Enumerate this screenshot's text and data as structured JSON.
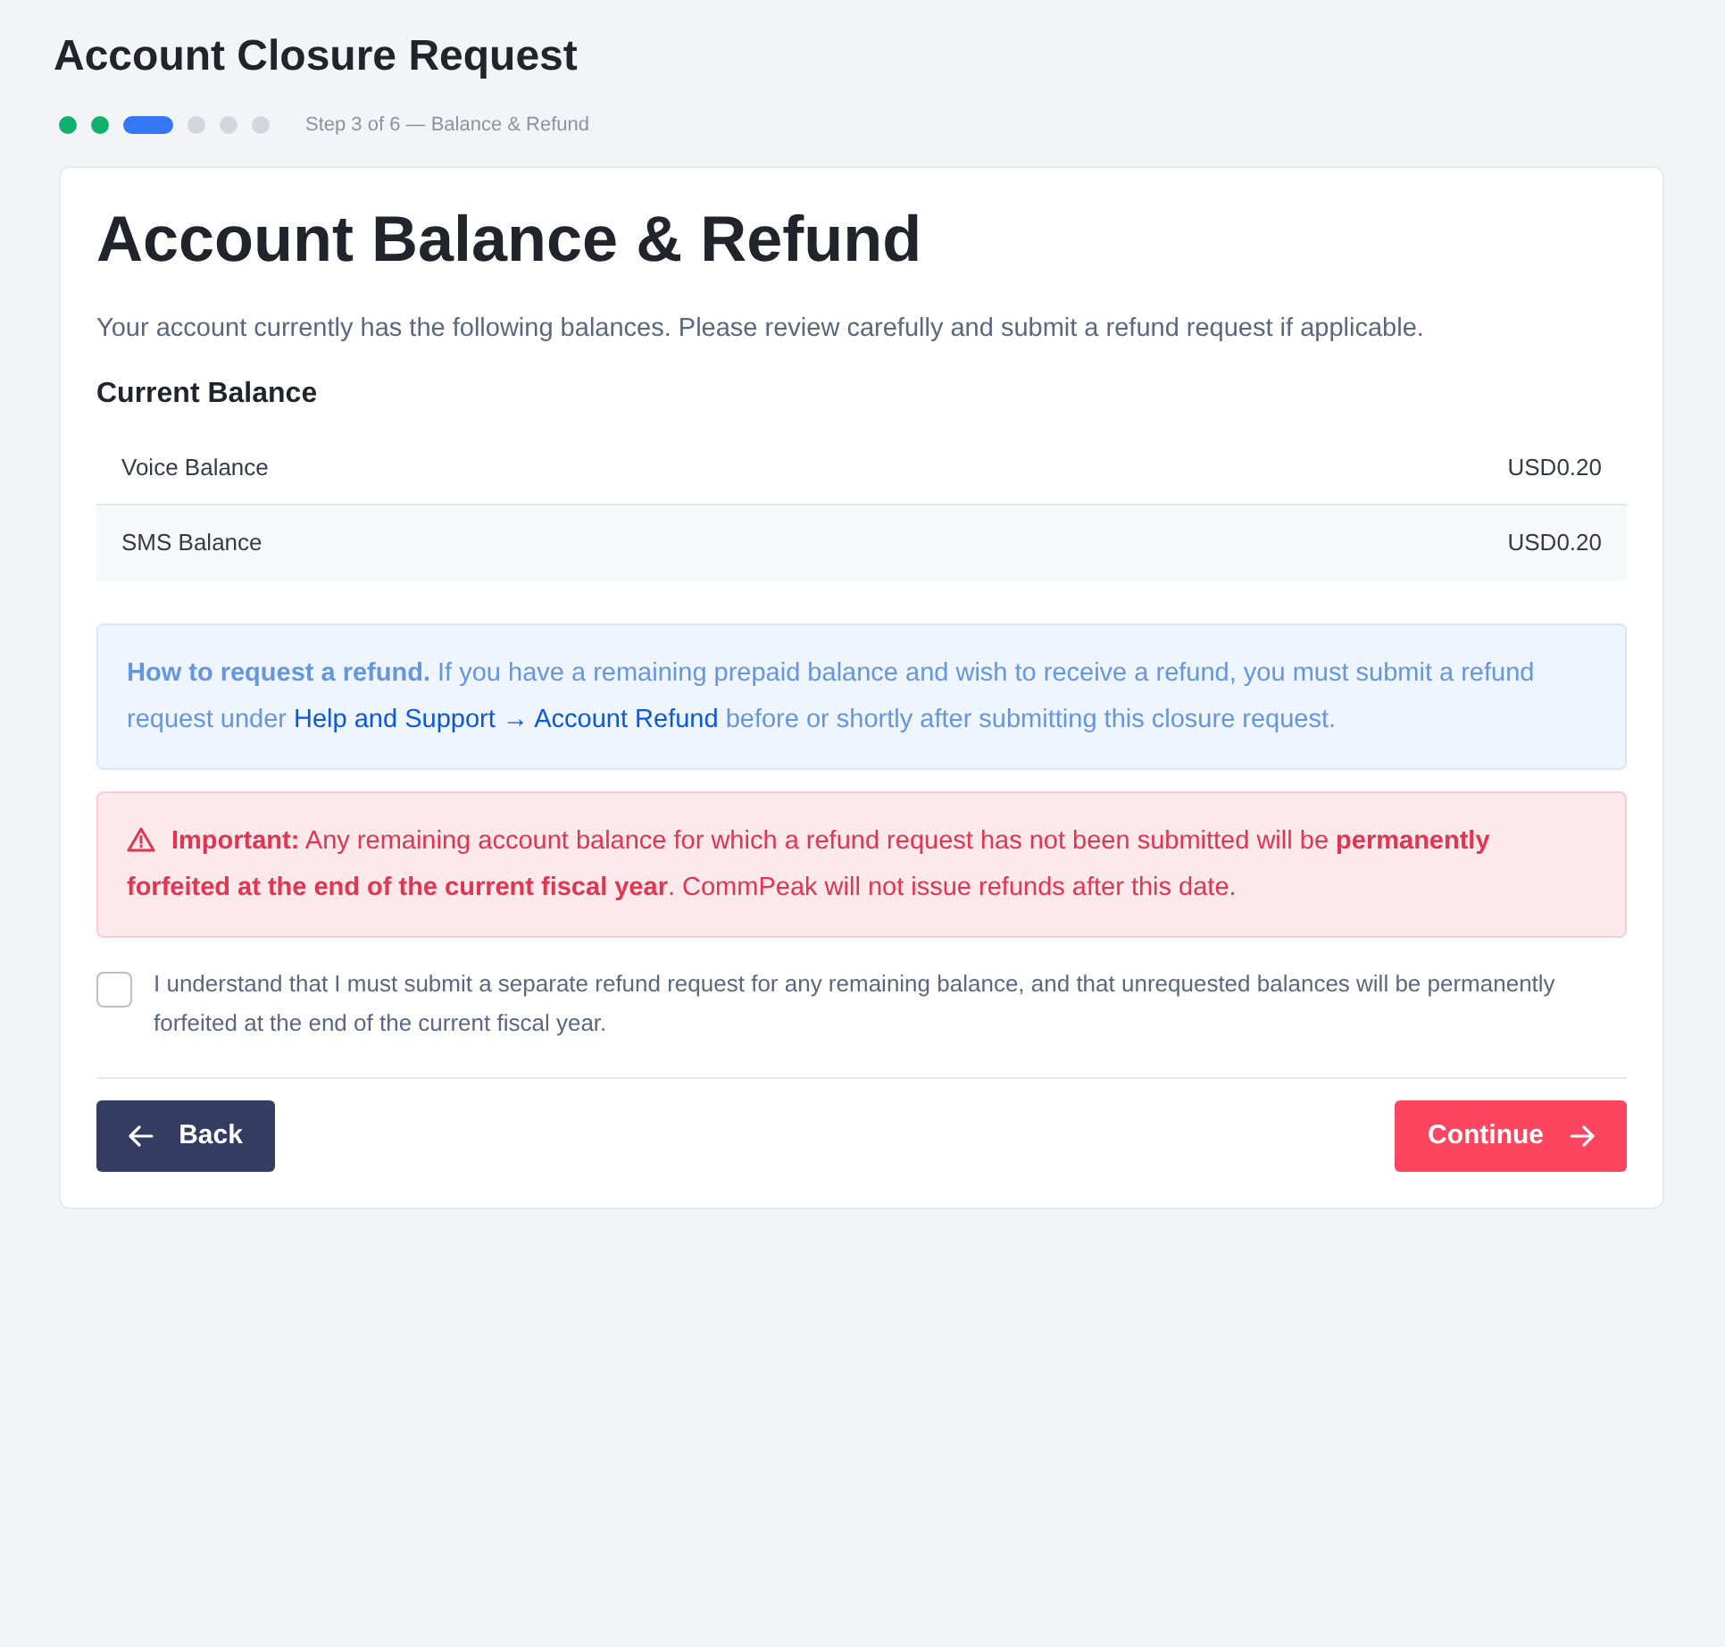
{
  "page": {
    "title": "Account Closure Request"
  },
  "progress": {
    "steps": [
      {
        "completed": true,
        "selected": false
      },
      {
        "completed": true,
        "selected": false
      },
      {
        "completed": false,
        "selected": true
      },
      {
        "completed": false,
        "selected": false
      },
      {
        "completed": false,
        "selected": false
      },
      {
        "completed": false,
        "selected": false
      }
    ],
    "label": "Step 3 of 6 — Balance & Refund"
  },
  "card": {
    "heading": "Account Balance & Refund",
    "intro": "Your account currently has the following balances. Please review carefully and submit a refund request if applicable.",
    "balance": {
      "title": "Current Balance",
      "rows": [
        {
          "label": "Voice Balance",
          "value": "USD0.20"
        },
        {
          "label": "SMS Balance",
          "value": "USD0.20"
        }
      ]
    },
    "info_notice": {
      "text_before": "**How to request a refund.** If you have a remaining prepaid balance and wish to receive a refund, you must submit a refund request under ",
      "link": "Help and Support → Account Refund",
      "text_after": " before or shortly after submitting this closure request."
    },
    "warning_notice": {
      "text": "**Important:** Any remaining account balance for which a refund request has not been submitted will be **permanently forfeited at the end of the current fiscal year**. CommPeak will not issue refunds after this date."
    },
    "acknowledgement": {
      "label": "I understand that I must submit a separate refund request for any remaining balance, and that unrequested balances will be permanently forfeited at the end of the current fiscal year.",
      "checked": false
    },
    "buttons": [
      {
        "label": "Back",
        "kind": "back"
      },
      {
        "label": "Continue",
        "kind": "continue"
      }
    ]
  }
}
